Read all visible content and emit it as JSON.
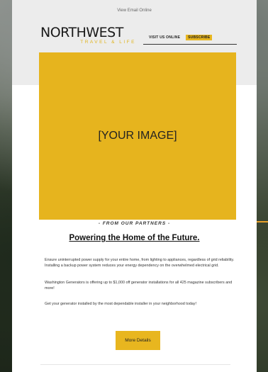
{
  "header": {
    "view_online": "View Email Online",
    "logo_main": "NORTHWEST",
    "logo_sub": "TRAVEL & LIFE",
    "nav_visit": "VISIT US ONLINE",
    "nav_subscribe": "SUBSCRIBE"
  },
  "hero": {
    "placeholder": "[YOUR IMAGE]",
    "color": "#e6b41e"
  },
  "article": {
    "eyebrow": "- FROM OUR PARTNERS -",
    "headline": "Powering the Home of the Future.",
    "paragraphs": [
      "Ensure uninterrupted power supply for your entire home, from lighting to appliances, regardless of grid reliability. Installing a backup power system reduces your energy dependency on the overwhelmed electrical grid.",
      "Washington Generators is offering up to $1,000 off generator installations for all 425 magazine subscribers and more!",
      "Get your generator installed by the most dependable installer in your neighborhood today!"
    ],
    "cta_label": "More Details"
  },
  "colors": {
    "accent": "#e8b61f",
    "header_band": "#ececec"
  }
}
